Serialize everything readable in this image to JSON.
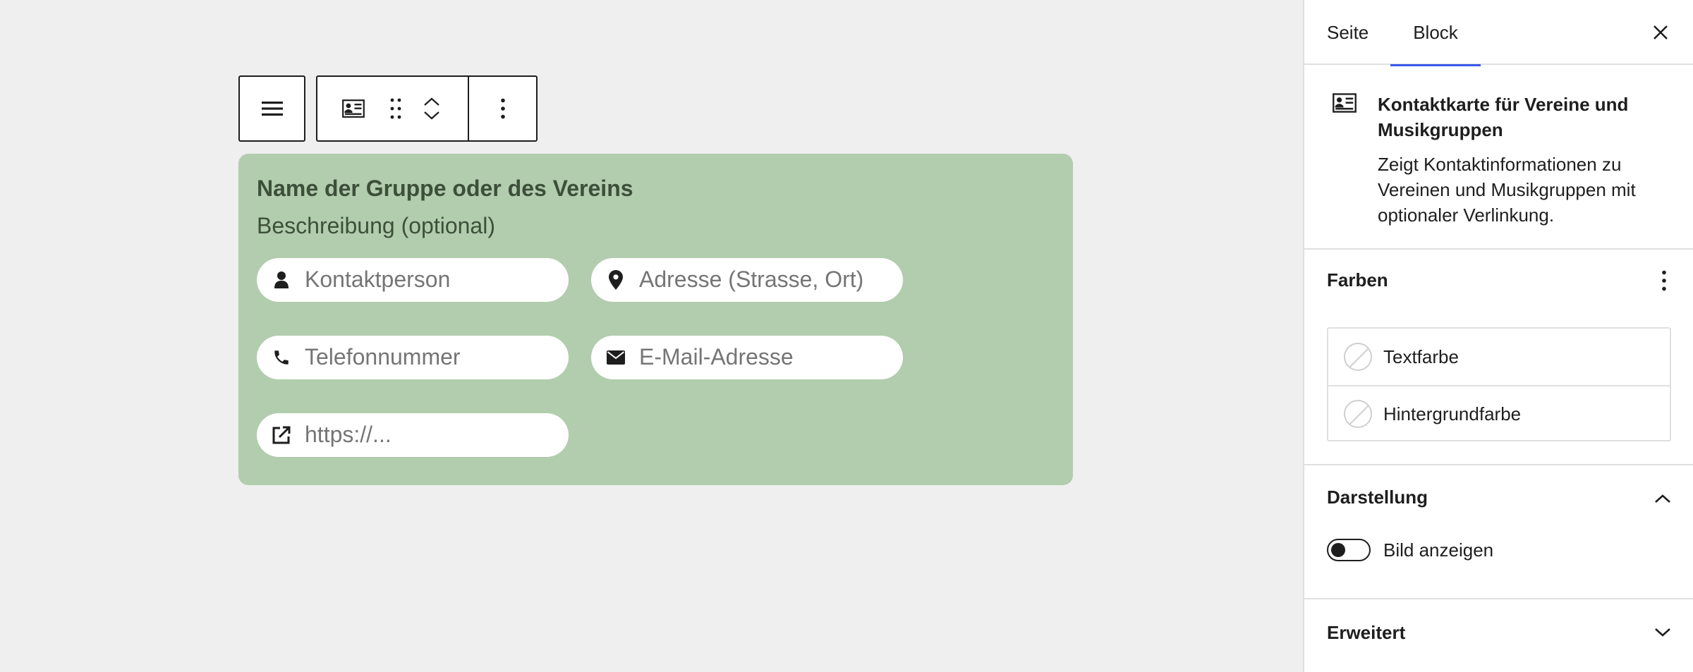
{
  "toolbar": {
    "parent_icon": "list-view-icon",
    "block_icon": "contact-card-icon",
    "drag_icon": "drag-handle-icon",
    "move_up_icon": "chevron-up-icon",
    "move_down_icon": "chevron-down-icon",
    "options_icon": "more-vertical-icon"
  },
  "block": {
    "background": "#b1cdad",
    "title": "Name der Gruppe oder des Vereins",
    "description": "Beschreibung (optional)",
    "fields": [
      {
        "icon": "person-icon",
        "placeholder": "Kontaktperson"
      },
      {
        "icon": "location-pin-icon",
        "placeholder": "Adresse (Strasse, Ort)"
      },
      {
        "icon": "phone-icon",
        "placeholder": "Telefonnummer"
      },
      {
        "icon": "envelope-icon",
        "placeholder": "E-Mail-Adresse"
      },
      {
        "icon": "external-link-icon",
        "placeholder": "https://..."
      }
    ]
  },
  "sidebar": {
    "tabs": [
      {
        "label": "Seite",
        "active": false
      },
      {
        "label": "Block",
        "active": true
      }
    ],
    "accent": "#3858e9",
    "block_card": {
      "title": "Kontaktkarte für Vereine und Musikgruppen",
      "description": "Zeigt Kontaktinformationen zu Vereinen und Musikgruppen mit optionaler Verlinkung."
    },
    "farben": {
      "heading": "Farben",
      "items": [
        {
          "label": "Textfarbe"
        },
        {
          "label": "Hintergrundfarbe"
        }
      ]
    },
    "darstellung": {
      "heading": "Darstellung",
      "expanded": true,
      "toggle_label": "Bild anzeigen",
      "toggle_on": false
    },
    "erweitert": {
      "heading": "Erweitert",
      "expanded": false
    }
  }
}
